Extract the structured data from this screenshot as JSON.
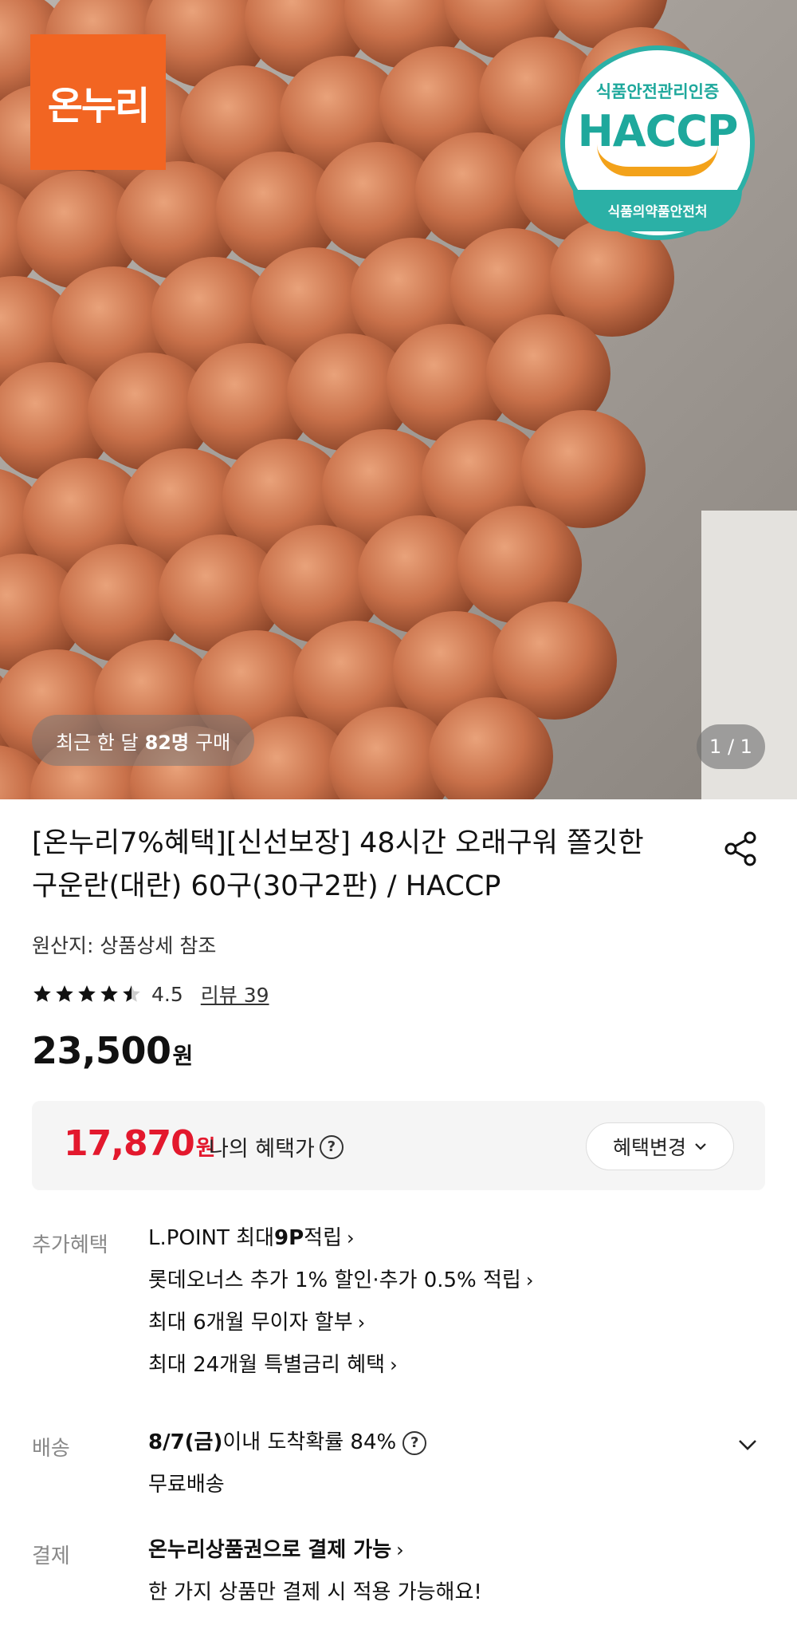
{
  "hero": {
    "logo_text": "온누리",
    "haccp_top": "식품안전관리인증",
    "haccp_main": "HACCP",
    "haccp_bottom": "식품의약품안전처",
    "recent_prefix": "최근 한 달",
    "recent_count": "82명",
    "recent_suffix": "구매",
    "page_indicator": "1 / 1"
  },
  "product": {
    "title_line1": "[온누리7%혜택][신선보장] 48시간 오래구워 쫄깃한",
    "title_line2": "구운란(대란) 60구(30구2판) / HACCP",
    "origin": "원산지: 상품상세 참조",
    "rating": "4.5",
    "rating_fraction": 0.9,
    "review_label": "리뷰 39",
    "price": "23,500",
    "currency": "원"
  },
  "benefit": {
    "price": "17,870",
    "currency": "원",
    "label": "나의 혜택가",
    "help": "?",
    "change_button": "혜택변경",
    "change_chevron": "⌄"
  },
  "extra": {
    "label": "추가혜택",
    "items": [
      {
        "pre": "L.POINT 최대 ",
        "bold": "9P",
        "post": " 적립",
        "chev": "›"
      },
      {
        "pre": "롯데오너스 추가 1% 할인·추가 0.5% 적립",
        "bold": "",
        "post": "",
        "chev": "›"
      },
      {
        "pre": "최대 6개월 무이자 할부",
        "bold": "",
        "post": "",
        "chev": "›"
      },
      {
        "pre": "최대 24개월 특별금리 혜택",
        "bold": "",
        "post": "",
        "chev": "›"
      }
    ]
  },
  "delivery": {
    "label": "배송",
    "date": "8/7(금)",
    "text": " 이내 도착확률 84%",
    "help": "?",
    "shipping": "무료배송"
  },
  "payment": {
    "label": "결제",
    "main": "온누리상품권으로 결제 가능",
    "chev": "›",
    "sub": "한 가지 상품만 결제 시 적용 가능해요!"
  },
  "colors": {
    "accent_red": "#e3182d",
    "logo_orange": "#f26522",
    "haccp_teal": "#2bb0a6"
  },
  "icons": [
    "share-icon",
    "star-icon",
    "help-icon",
    "chevron-right-icon",
    "chevron-down-icon"
  ]
}
